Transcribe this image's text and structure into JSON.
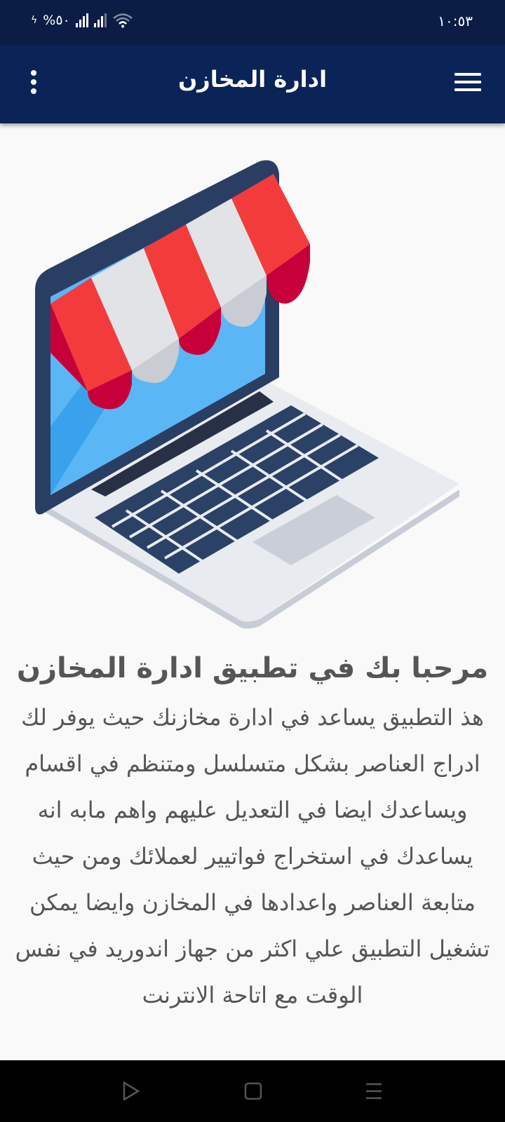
{
  "status_bar": {
    "time": "١٠:٥٣",
    "battery": "%٥٠"
  },
  "app_bar": {
    "title": "ادارة المخازن",
    "menu_icon": "hamburger-menu-icon",
    "more_icon": "more-vertical-icon"
  },
  "hero": {
    "illustration": "laptop-store-illustration"
  },
  "content": {
    "title": "مرحبا بك في تطبيق ادارة المخازن",
    "description": "هذ التطبيق يساعد في ادارة مخازنك حيث يوفر لك ادراج العناصر بشكل متسلسل ومتنظم في اقسام ويساعدك ايضا في التعديل عليهم واهم مابه انه يساعدك في استخراج فواتيير لعملائك ومن حيث متابعة العناصر واعدادها في المخازن وايضا يمكن تشغيل التطبيق علي اكثر من جهاز اندوريد في نفس الوقت مع اتاحة الانترنت"
  },
  "nav_bar": {
    "back_icon": "back-triangle-icon",
    "home_icon": "home-square-icon",
    "recents_icon": "recents-menu-icon"
  },
  "colors": {
    "status_bar": "#0b1d45",
    "app_bar": "#0b2458",
    "text": "#555555",
    "awning_red": "#f43b3b",
    "screen_blue": "#5bb6f5"
  }
}
